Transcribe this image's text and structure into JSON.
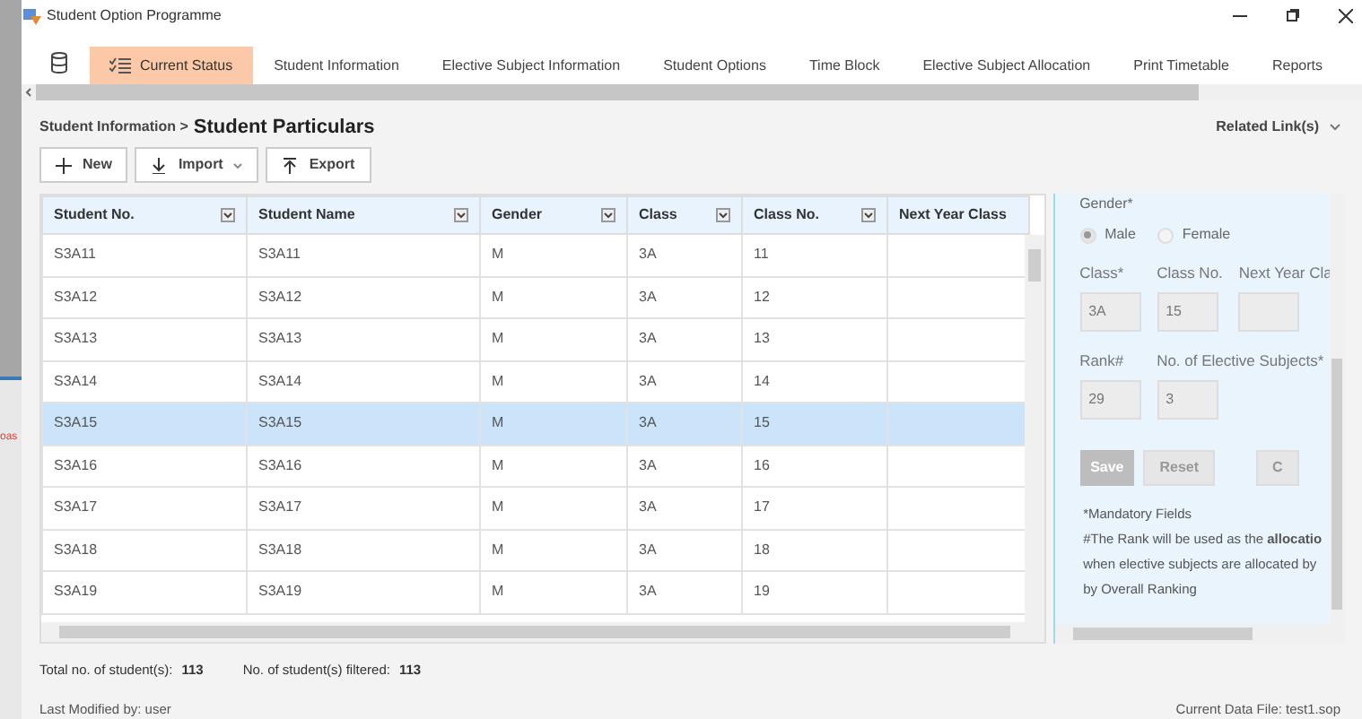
{
  "background_window": {
    "text": "oas"
  },
  "window": {
    "title": "Student Option Programme"
  },
  "tabs": [
    {
      "label": "Current Status",
      "selected": true,
      "kind": "status"
    },
    {
      "label": "Student Information",
      "selected": false
    },
    {
      "label": "Elective Subject Information",
      "selected": false
    },
    {
      "label": "Student Options",
      "selected": false
    },
    {
      "label": "Time Block",
      "selected": false
    },
    {
      "label": "Elective Subject Allocation",
      "selected": false
    },
    {
      "label": "Print Timetable",
      "selected": false
    },
    {
      "label": "Reports",
      "selected": false
    }
  ],
  "breadcrumb": {
    "parent": "Student Information >",
    "current": "Student Particulars"
  },
  "related_links": "Related Link(s)",
  "toolbar": [
    {
      "label": "New",
      "kind": "new"
    },
    {
      "label": "Import",
      "kind": "import"
    },
    {
      "label": "Export",
      "kind": "export"
    }
  ],
  "table": {
    "columns": [
      "Student No.",
      "Student Name",
      "Gender",
      "Class",
      "Class No.",
      "Next Year Class"
    ],
    "filters": [
      true,
      true,
      true,
      true,
      true,
      false
    ],
    "rows": [
      {
        "cells": [
          "S3A11",
          "S3A11",
          "M",
          "3A",
          "11"
        ],
        "selected": false
      },
      {
        "cells": [
          "S3A12",
          "S3A12",
          "M",
          "3A",
          "12"
        ],
        "selected": false
      },
      {
        "cells": [
          "S3A13",
          "S3A13",
          "M",
          "3A",
          "13"
        ],
        "selected": false
      },
      {
        "cells": [
          "S3A14",
          "S3A14",
          "M",
          "3A",
          "14"
        ],
        "selected": false
      },
      {
        "cells": [
          "S3A15",
          "S3A15",
          "M",
          "3A",
          "15"
        ],
        "selected": true
      },
      {
        "cells": [
          "S3A16",
          "S3A16",
          "M",
          "3A",
          "16"
        ],
        "selected": false
      },
      {
        "cells": [
          "S3A17",
          "S3A17",
          "M",
          "3A",
          "17"
        ],
        "selected": false
      },
      {
        "cells": [
          "S3A18",
          "S3A18",
          "M",
          "3A",
          "18"
        ],
        "selected": false
      },
      {
        "cells": [
          "S3A19",
          "S3A19",
          "M",
          "3A",
          "19"
        ],
        "selected": false
      }
    ]
  },
  "form": {
    "gender_label": "Gender*",
    "gender_options": [
      {
        "label": "Male",
        "selected": true
      },
      {
        "label": "Female",
        "selected": false
      }
    ],
    "field_rows": [
      [
        {
          "label": "Class*",
          "value": "3A"
        },
        {
          "label": "Class No.",
          "value": "15"
        },
        {
          "label": "Next Year Cla"
        }
      ],
      [
        {
          "label": "Rank#",
          "value": "29"
        },
        {
          "label": "No. of Elective Subjects*",
          "value": "3"
        }
      ]
    ],
    "buttons": [
      {
        "label": "Save",
        "kind": "primary"
      },
      {
        "label": "Reset",
        "kind": "secondary"
      },
      {
        "label": "C",
        "kind": "secondary"
      }
    ],
    "notes": [
      "*Mandatory Fields",
      "#The Rank will be used as the **allocatio**",
      "when elective subjects are allocated by",
      "by Overall Ranking"
    ]
  },
  "summary": [
    {
      "label": "Total no. of student(s):",
      "value": "113"
    },
    {
      "label": "No. of student(s) filtered:",
      "value": "113"
    }
  ],
  "status_bar": {
    "left": "Last Modified by: user",
    "right": "Current Data File: test1.sop"
  }
}
